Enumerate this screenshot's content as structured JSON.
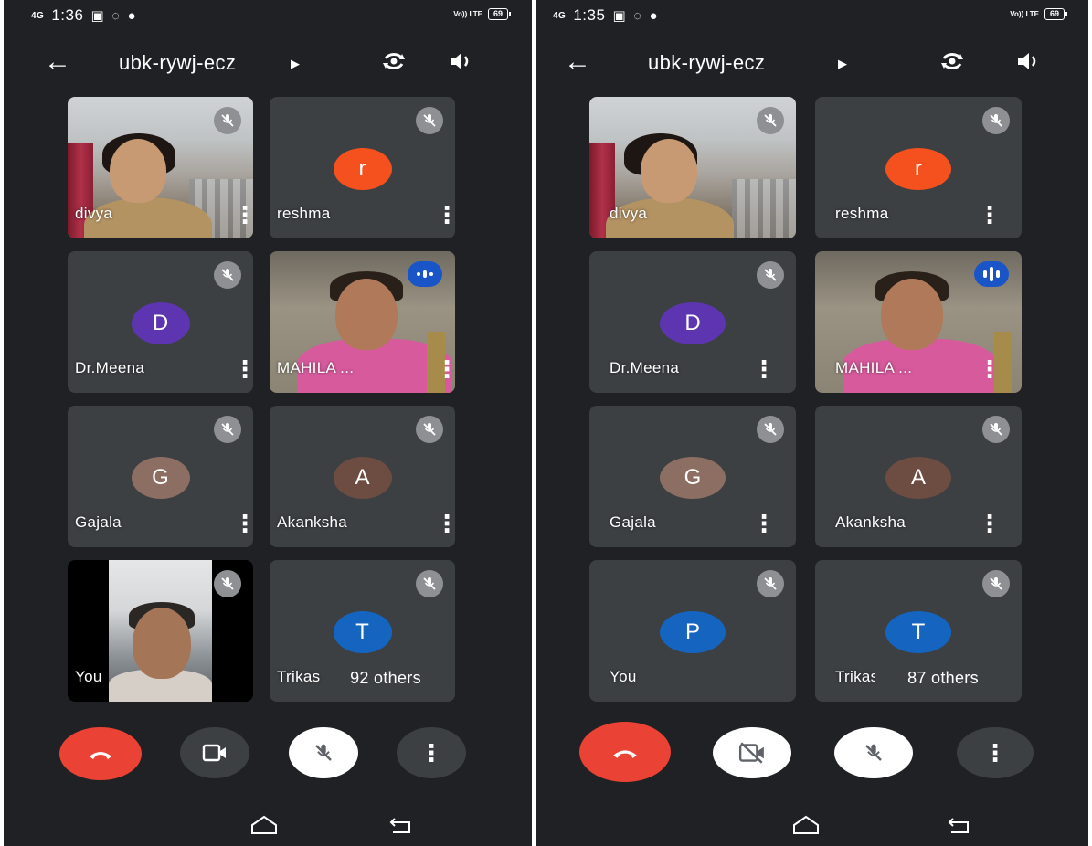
{
  "colors": {
    "background": "#202124",
    "tile": "#3c4043",
    "end_call": "#ea4335",
    "speaking": "#1a55c8"
  },
  "screens": [
    {
      "status": {
        "signal": "4G",
        "time": "1:36",
        "icons": [
          "gallery-icon",
          "whatsapp-icon",
          "telegram-icon"
        ],
        "lte": "Vo)) LTE",
        "battery": "69"
      },
      "meeting_code": "ubk-rywj-ecz",
      "tiles": [
        {
          "name": "divya",
          "kind": "video"
        },
        {
          "name": "reshma",
          "kind": "avatar",
          "initial": "r",
          "color": "#f4511e"
        },
        {
          "name": "Dr.Meena",
          "kind": "avatar",
          "initial": "D",
          "color": "#5e35b1"
        },
        {
          "name": "MAHILA ...",
          "kind": "video-speaking"
        },
        {
          "name": "Gajala",
          "kind": "avatar",
          "initial": "G",
          "color": "#8d6e63"
        },
        {
          "name": "Akanksha",
          "kind": "avatar",
          "initial": "A",
          "color": "#6d4c41"
        },
        {
          "name": "You",
          "kind": "video-self"
        },
        {
          "name": "Trikas",
          "kind": "avatar",
          "initial": "T",
          "color": "#1565c0"
        }
      ],
      "others_label": "92 others",
      "camera_state": "on",
      "mic_state": "off"
    },
    {
      "status": {
        "signal": "4G",
        "time": "1:35",
        "icons": [
          "gallery-icon",
          "whatsapp-icon",
          "telegram-icon"
        ],
        "lte": "Vo)) LTE",
        "battery": "69"
      },
      "meeting_code": "ubk-rywj-ecz",
      "tiles": [
        {
          "name": "divya",
          "kind": "video"
        },
        {
          "name": "reshma",
          "kind": "avatar",
          "initial": "r",
          "color": "#f4511e"
        },
        {
          "name": "Dr.Meena",
          "kind": "avatar",
          "initial": "D",
          "color": "#5e35b1"
        },
        {
          "name": "MAHILA ...",
          "kind": "video-speaking"
        },
        {
          "name": "Gajala",
          "kind": "avatar",
          "initial": "G",
          "color": "#8d6e63"
        },
        {
          "name": "Akanksha",
          "kind": "avatar",
          "initial": "A",
          "color": "#6d4c41"
        },
        {
          "name": "You",
          "kind": "avatar",
          "initial": "P",
          "color": "#1565c0"
        },
        {
          "name": "Trikas",
          "kind": "avatar",
          "initial": "T",
          "color": "#1565c0"
        }
      ],
      "others_label": "87 others",
      "camera_state": "off",
      "mic_state": "off"
    }
  ]
}
